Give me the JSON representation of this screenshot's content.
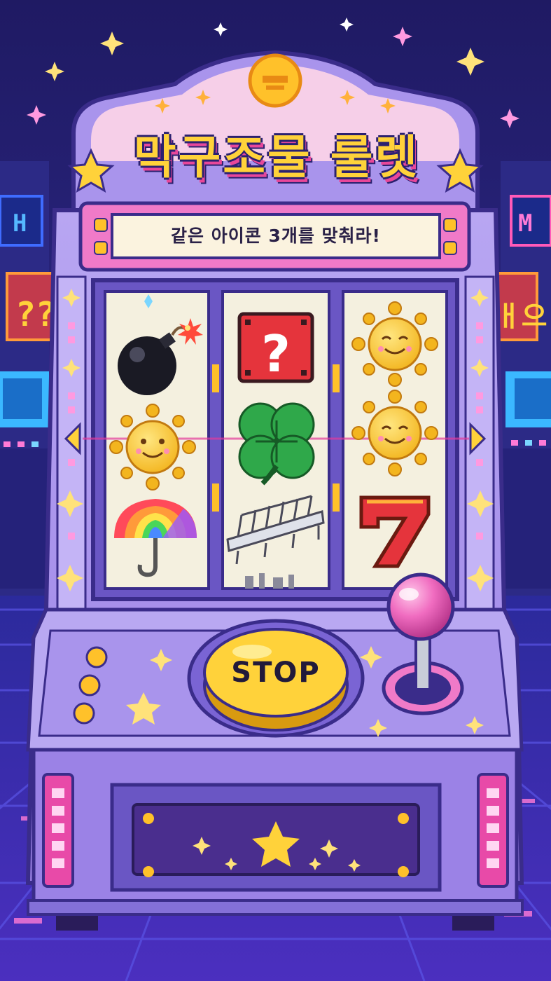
{
  "machine": {
    "title": "막구조물 룰렛",
    "subtitle": "같은 아이콘 3개를 맞춰라!",
    "stop_label": "STOP"
  },
  "background": {
    "left_sign": "??",
    "right_sign": "ㅐ으"
  },
  "reels": [
    {
      "name": "reel-1",
      "symbols": [
        "bomb-icon",
        "sun-icon",
        "rainbow-umbrella-icon"
      ]
    },
    {
      "name": "reel-2",
      "symbols": [
        "question-block-icon",
        "four-leaf-clover-icon",
        "bridge-icon"
      ]
    },
    {
      "name": "reel-3",
      "symbols": [
        "sun-icon",
        "sun-icon",
        "seven-icon"
      ]
    }
  ],
  "colors": {
    "cabinet": "#a994ec",
    "cabinet_dark": "#6a56c4",
    "reel_bg": "#f4f0df",
    "accent_yellow": "#ffd23a",
    "accent_pink": "#f07ac8",
    "background": "#231a6a"
  }
}
